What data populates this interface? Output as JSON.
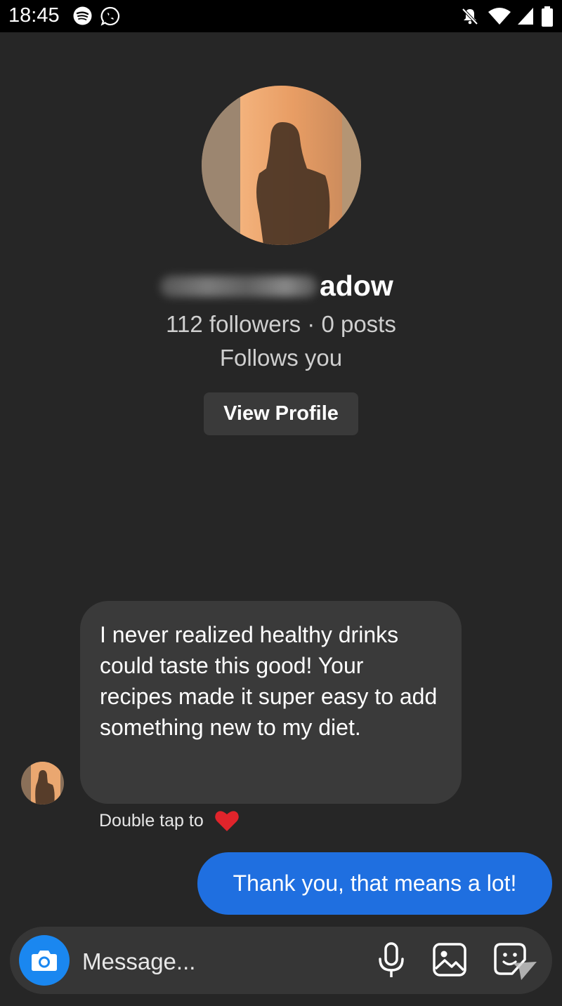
{
  "status_bar": {
    "time": "18:45",
    "left_icons": [
      "spotify-icon",
      "whatsapp-icon"
    ],
    "right_icons": [
      "bell-muted-icon",
      "wifi-icon",
      "cell-signal-icon",
      "battery-icon"
    ]
  },
  "profile": {
    "username_visible_part": "adow",
    "username_obscured": true,
    "stats": "112 followers · 0 posts",
    "relation": "Follows you",
    "view_profile_label": "View Profile"
  },
  "messages": [
    {
      "direction": "incoming",
      "text": "I never realized healthy drinks could taste this good! Your recipes made it super easy to add something new to my diet."
    },
    {
      "direction": "outgoing",
      "text": "Thank you, that means a lot!"
    }
  ],
  "reaction_hint": {
    "text": "Double tap to",
    "icon": "heart-icon"
  },
  "composer": {
    "placeholder": "Message...",
    "icons": [
      "camera-icon",
      "microphone-icon",
      "gallery-icon",
      "sticker-icon"
    ]
  },
  "colors": {
    "background": "#262626",
    "bubble_incoming": "#3a3a3a",
    "bubble_outgoing": "#1f6fe0",
    "camera_button": "#1a87f0",
    "heart": "#e0242b"
  }
}
